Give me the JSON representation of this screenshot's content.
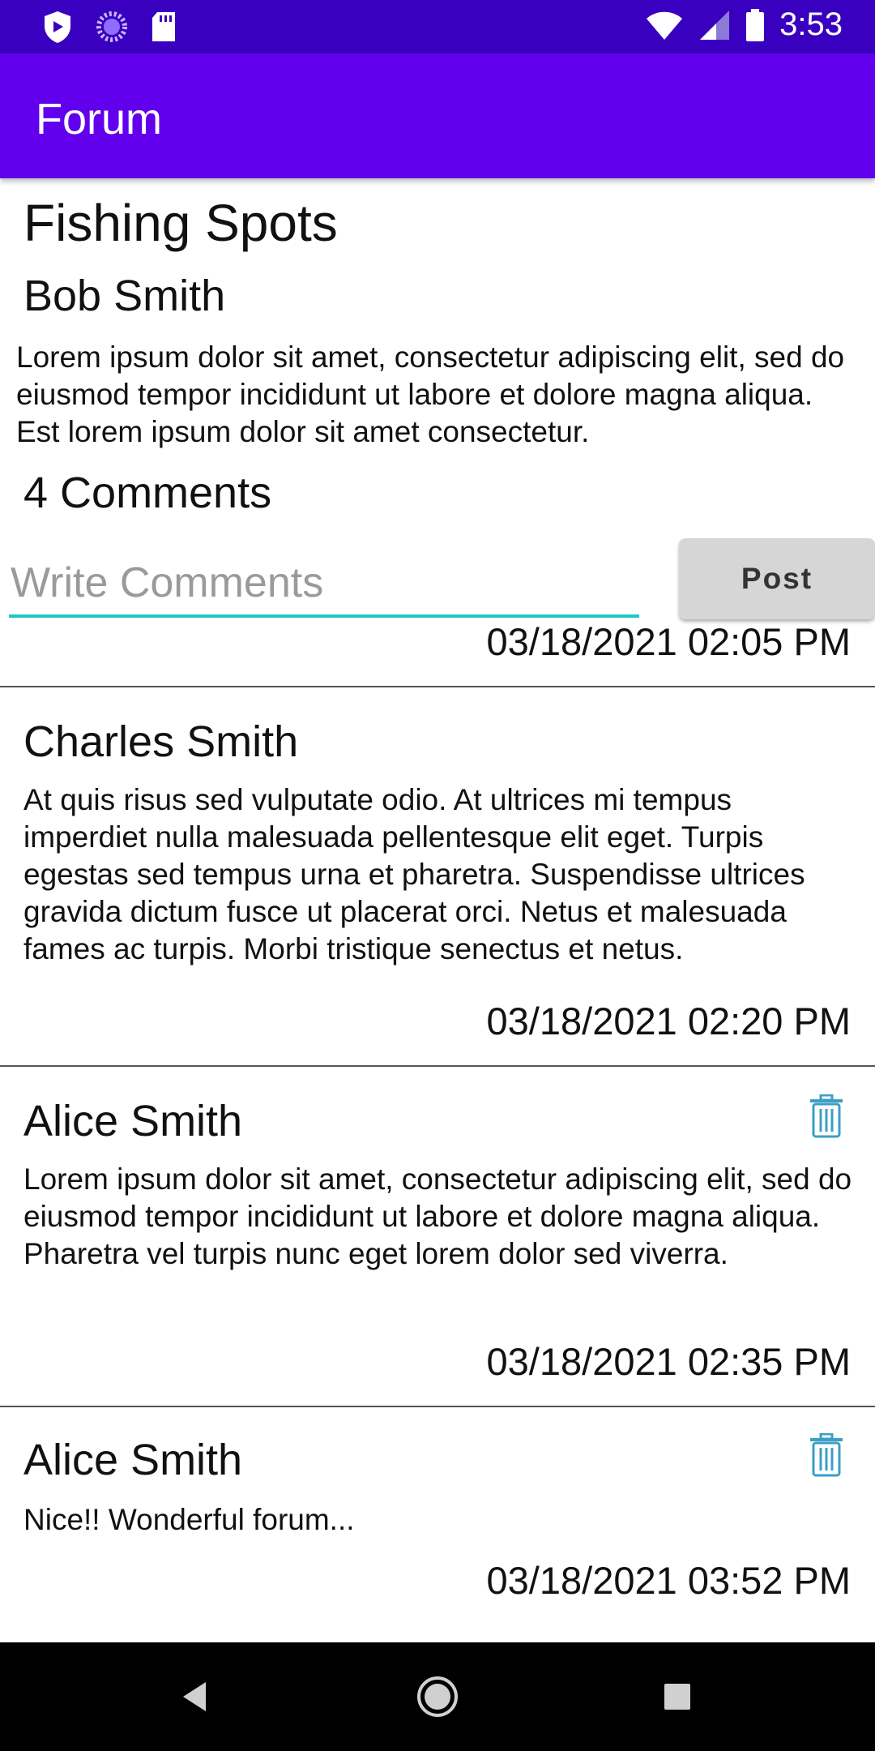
{
  "status_bar": {
    "time": "3:53",
    "left_icons": [
      "shield-icon",
      "sync-icon",
      "sd-card-icon"
    ],
    "right_icons": [
      "wifi-icon",
      "signal-icon",
      "battery-icon"
    ]
  },
  "app_bar": {
    "title": "Forum"
  },
  "post": {
    "title": "Fishing Spots",
    "author": "Bob Smith",
    "body": "Lorem ipsum dolor sit amet, consectetur adipiscing elit, sed do eiusmod tempor incididunt ut labore et dolore magna aliqua. Est lorem ipsum dolor sit amet consectetur.",
    "comment_count": "4 Comments"
  },
  "comment_form": {
    "placeholder": "Write Comments",
    "value": "",
    "post_label": "Post"
  },
  "comments": [
    {
      "author": "",
      "body": "",
      "date": "03/18/2021 02:05 PM",
      "deletable": false
    },
    {
      "author": "Charles Smith",
      "body": "At quis risus sed vulputate odio. At ultrices mi tempus imperdiet nulla malesuada pellentesque elit eget. Turpis egestas sed tempus urna et pharetra. Suspendisse ultrices gravida dictum fusce ut placerat orci. Netus et malesuada fames ac turpis. Morbi tristique senectus et netus.",
      "date": "03/18/2021 02:20 PM",
      "deletable": false
    },
    {
      "author": "Alice Smith",
      "body": "Lorem ipsum dolor sit amet, consectetur adipiscing elit, sed do eiusmod tempor incididunt ut labore et dolore magna aliqua. Pharetra vel turpis nunc eget lorem dolor sed viverra.",
      "date": "03/18/2021 02:35 PM",
      "deletable": true
    },
    {
      "author": "Alice Smith",
      "body": "Nice!! Wonderful forum...",
      "date": "03/18/2021 03:52 PM",
      "deletable": true
    }
  ],
  "nav_bar": {
    "icons": [
      "back-icon",
      "home-icon",
      "recents-icon"
    ]
  },
  "colors": {
    "status_bar": "#3a00bf",
    "app_bar": "#6200ee",
    "input_underline": "#1dc7c7",
    "trash_icon": "#3a9fc7",
    "post_button_bg": "#d6d6d6"
  }
}
